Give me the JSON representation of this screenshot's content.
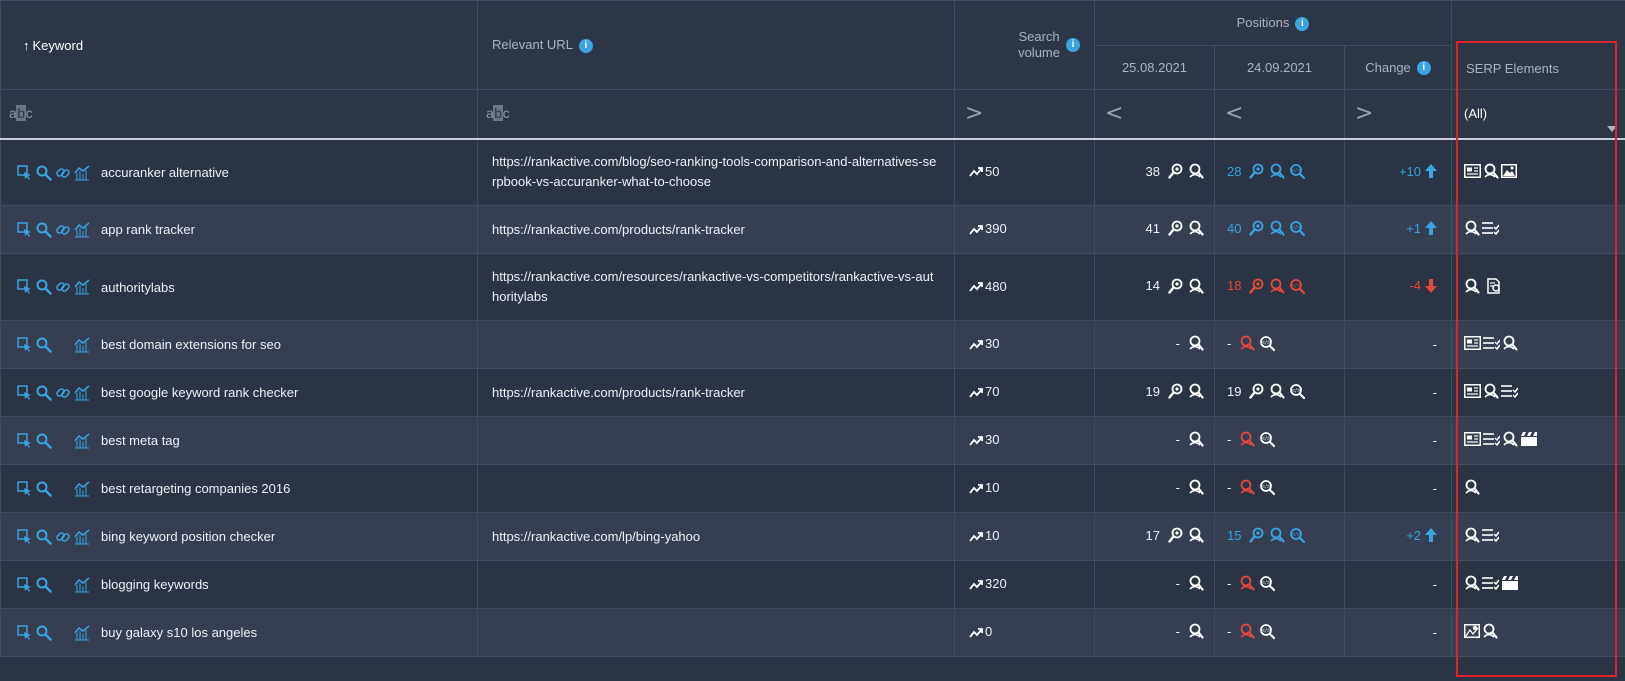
{
  "header": {
    "keyword": "Keyword",
    "sort_arrow": "↑",
    "relevant_url": "Relevant URL",
    "search_volume_line1": "Search",
    "search_volume_line2": "volume",
    "positions": "Positions",
    "date1": "25.08.2021",
    "date2": "24.09.2021",
    "change": "Change",
    "serp_elements": "SERP Elements"
  },
  "filters": {
    "keyword_a": "a",
    "keyword_b": "b",
    "keyword_c": "c",
    "url_a": "a",
    "url_b": "b",
    "url_c": "c",
    "volume_op": ">",
    "date1_op": "<",
    "date2_op": "<",
    "change_op": ">",
    "serp_select": "(All)"
  },
  "rows": [
    {
      "keyword": "accuranker alternative",
      "url": "https://rankactive.com/blog/seo-ranking-tools-comparison-and-alternatives-serpbook-vs-accuranker-what-to-choose",
      "volume": "50",
      "pos1": "38",
      "pos2": "28",
      "change": "+10"
    },
    {
      "keyword": "app rank tracker",
      "url": "https://rankactive.com/products/rank-tracker",
      "volume": "390",
      "pos1": "41",
      "pos2": "40",
      "change": "+1"
    },
    {
      "keyword": "authoritylabs",
      "url": "https://rankactive.com/resources/rankactive-vs-competitors/rankactive-vs-authoritylabs",
      "volume": "480",
      "pos1": "14",
      "pos2": "18",
      "change": "-4"
    },
    {
      "keyword": "best domain extensions for seo",
      "url": "",
      "volume": "30",
      "pos1": "-",
      "pos2": "-",
      "change": "-"
    },
    {
      "keyword": "best google keyword rank checker",
      "url": "https://rankactive.com/products/rank-tracker",
      "volume": "70",
      "pos1": "19",
      "pos2": "19",
      "change": "-"
    },
    {
      "keyword": "best meta tag",
      "url": "",
      "volume": "30",
      "pos1": "-",
      "pos2": "-",
      "change": "-"
    },
    {
      "keyword": "best retargeting companies 2016",
      "url": "",
      "volume": "10",
      "pos1": "-",
      "pos2": "-",
      "change": "-"
    },
    {
      "keyword": "bing keyword position checker",
      "url": "https://rankactive.com/lp/bing-yahoo",
      "volume": "10",
      "pos1": "17",
      "pos2": "15",
      "change": "+2"
    },
    {
      "keyword": "blogging keywords",
      "url": "",
      "volume": "320",
      "pos1": "-",
      "pos2": "-",
      "change": "-"
    },
    {
      "keyword": "buy galaxy s10 los angeles",
      "url": "",
      "volume": "0",
      "pos1": "-",
      "pos2": "-",
      "change": "-"
    }
  ],
  "colors": {
    "accent_blue": "#3aa3e0",
    "negative_red": "#e24a3b",
    "highlight_red": "#e0202a"
  }
}
